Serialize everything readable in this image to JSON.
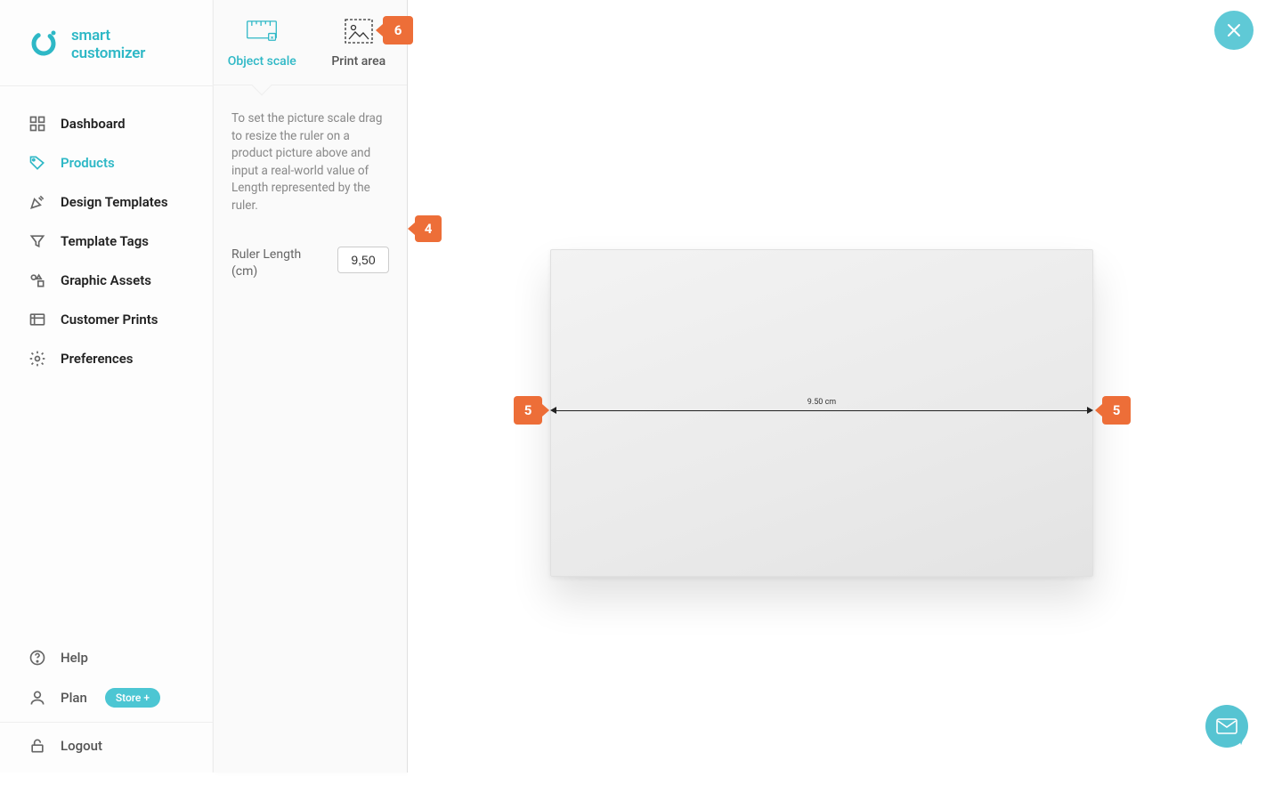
{
  "brand": {
    "name": "smart customizer"
  },
  "sidebar": {
    "items": [
      {
        "label": "Dashboard"
      },
      {
        "label": "Products"
      },
      {
        "label": "Design Templates"
      },
      {
        "label": "Template Tags"
      },
      {
        "label": "Graphic Assets"
      },
      {
        "label": "Customer Prints"
      },
      {
        "label": "Preferences"
      }
    ],
    "bottom": {
      "help": "Help",
      "plan": "Plan",
      "plan_badge": "Store +",
      "logout": "Logout"
    }
  },
  "tabs": {
    "object_scale": "Object scale",
    "print_area": "Print area"
  },
  "panel": {
    "help_text": "To set the picture scale drag to resize the ruler on a product picture above and input a real-world value of Length represented by the ruler.",
    "ruler_length_label": "Ruler Length (cm)",
    "ruler_length_value": "9,50"
  },
  "canvas": {
    "ruler_display": "9.50 cm"
  },
  "markers": {
    "m4": "4",
    "m5": "5",
    "m6": "6"
  }
}
